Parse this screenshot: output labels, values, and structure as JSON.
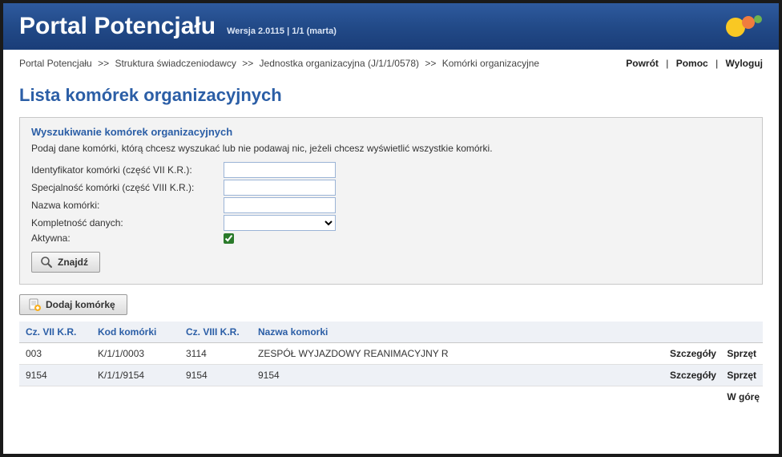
{
  "header": {
    "title": "Portal Potencjału",
    "subtitle": "Wersja 2.0115 | 1/1 (marta)"
  },
  "breadcrumb": {
    "items": [
      {
        "label": "Portal Potencjału"
      },
      {
        "label": "Struktura świadczeniodawcy"
      },
      {
        "label": "Jednostka organizacyjna (J/1/1/0578)"
      },
      {
        "label": "Komórki organizacyjne"
      }
    ],
    "separator": ">>"
  },
  "toplinks": {
    "back": "Powrót",
    "help": "Pomoc",
    "logout": "Wyloguj"
  },
  "page_heading": "Lista komórek organizacyjnych",
  "search": {
    "title": "Wyszukiwanie komórek organizacyjnych",
    "hint": "Podaj dane komórki, którą chcesz wyszukać lub nie podawaj nic, jeżeli chcesz wyświetlić wszystkie komórki.",
    "labels": {
      "identyfikator": "Identyfikator komórki (część VII K.R.):",
      "specjalnosc": "Specjalność komórki (część VIII K.R.):",
      "nazwa": "Nazwa komórki:",
      "kompletnosc": "Kompletność danych:",
      "aktywna": "Aktywna:"
    },
    "values": {
      "identyfikator": "",
      "specjalnosc": "",
      "nazwa": "",
      "kompletnosc": "",
      "aktywna": true
    },
    "find_button": "Znajdź"
  },
  "add_button": "Dodaj komórkę",
  "table": {
    "headers": {
      "cz7": "Cz. VII K.R.",
      "kod": "Kod komórki",
      "cz8": "Cz. VIII K.R.",
      "nazwa": "Nazwa komorki"
    },
    "row_links": {
      "szczegoly": "Szczegóły",
      "sprzet": "Sprzęt"
    },
    "rows": [
      {
        "cz7": "003",
        "kod": "K/1/1/0003",
        "cz8": "3114",
        "nazwa": "ZESPÓŁ WYJAZDOWY REANIMACYJNY R"
      },
      {
        "cz7": "9154",
        "kod": "K/1/1/9154",
        "cz8": "9154",
        "nazwa": "9154"
      }
    ]
  },
  "to_top": "W górę"
}
